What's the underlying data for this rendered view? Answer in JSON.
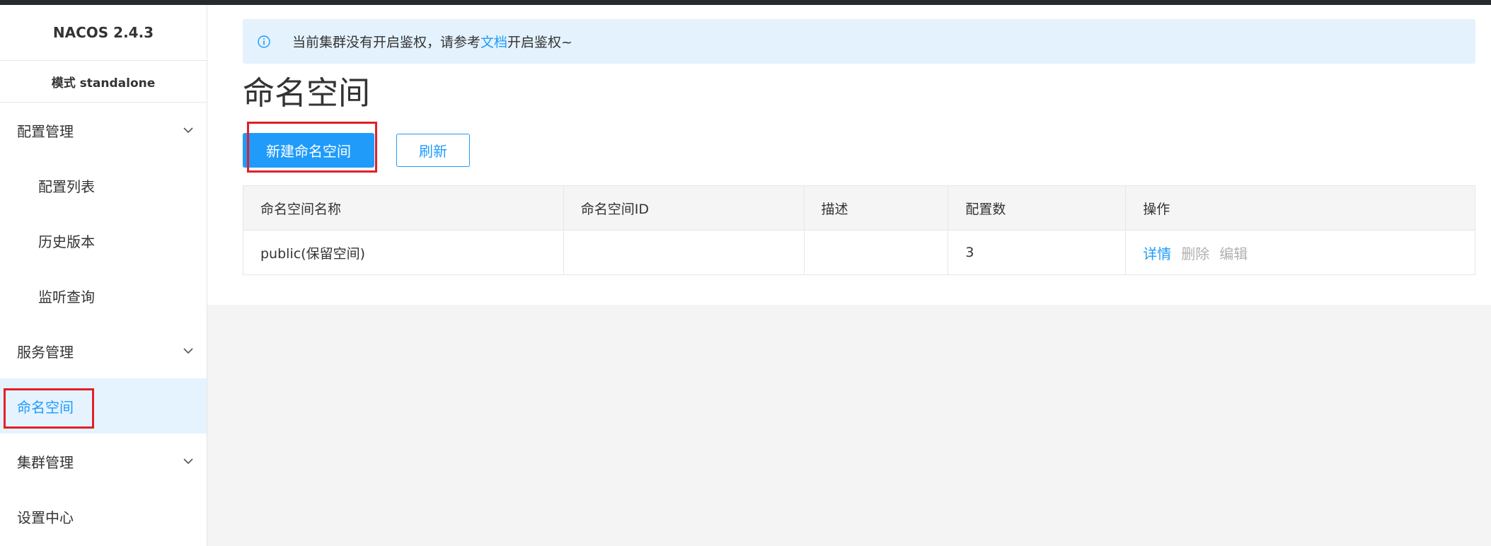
{
  "sidebar": {
    "brand": "NACOS 2.4.3",
    "mode": "模式 standalone",
    "items": [
      {
        "label": "配置管理",
        "type": "group"
      },
      {
        "label": "配置列表",
        "type": "sub"
      },
      {
        "label": "历史版本",
        "type": "sub"
      },
      {
        "label": "监听查询",
        "type": "sub"
      },
      {
        "label": "服务管理",
        "type": "group"
      },
      {
        "label": "命名空间",
        "type": "active"
      },
      {
        "label": "集群管理",
        "type": "group"
      },
      {
        "label": "设置中心",
        "type": "item"
      }
    ]
  },
  "alert": {
    "text_before": "当前集群没有开启鉴权，请参考",
    "link": "文档",
    "text_after": "开启鉴权~"
  },
  "page": {
    "title": "命名空间",
    "create_button": "新建命名空间",
    "refresh_button": "刷新"
  },
  "table": {
    "headers": [
      "命名空间名称",
      "命名空间ID",
      "描述",
      "配置数",
      "操作"
    ],
    "rows": [
      {
        "name": "public(保留空间)",
        "id": "",
        "desc": "",
        "count": "3",
        "actions": [
          "详情",
          "删除",
          "编辑"
        ]
      }
    ]
  },
  "colors": {
    "accent": "#209bfa",
    "highlight_box": "#e0202a",
    "active_bg": "#e5f3ff"
  }
}
